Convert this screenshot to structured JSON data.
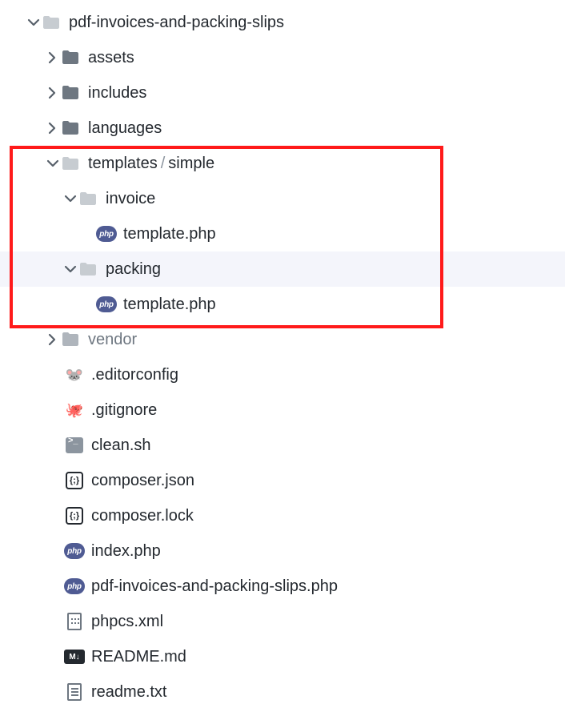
{
  "root": {
    "name": "pdf-invoices-and-packing-slips"
  },
  "folders": {
    "assets": "assets",
    "includes": "includes",
    "languages": "languages",
    "templates": "templates",
    "simple": "simple",
    "invoice": "invoice",
    "packing": "packing",
    "vendor": "vendor"
  },
  "files": {
    "template_php": "template.php",
    "editorconfig": ".editorconfig",
    "gitignore": ".gitignore",
    "clean_sh": "clean.sh",
    "composer_json": "composer.json",
    "composer_lock": "composer.lock",
    "index_php": "index.php",
    "main_php": "pdf-invoices-and-packing-slips.php",
    "phpcs_xml": "phpcs.xml",
    "readme_md": "README.md",
    "readme_txt": "readme.txt"
  },
  "separator": "/"
}
